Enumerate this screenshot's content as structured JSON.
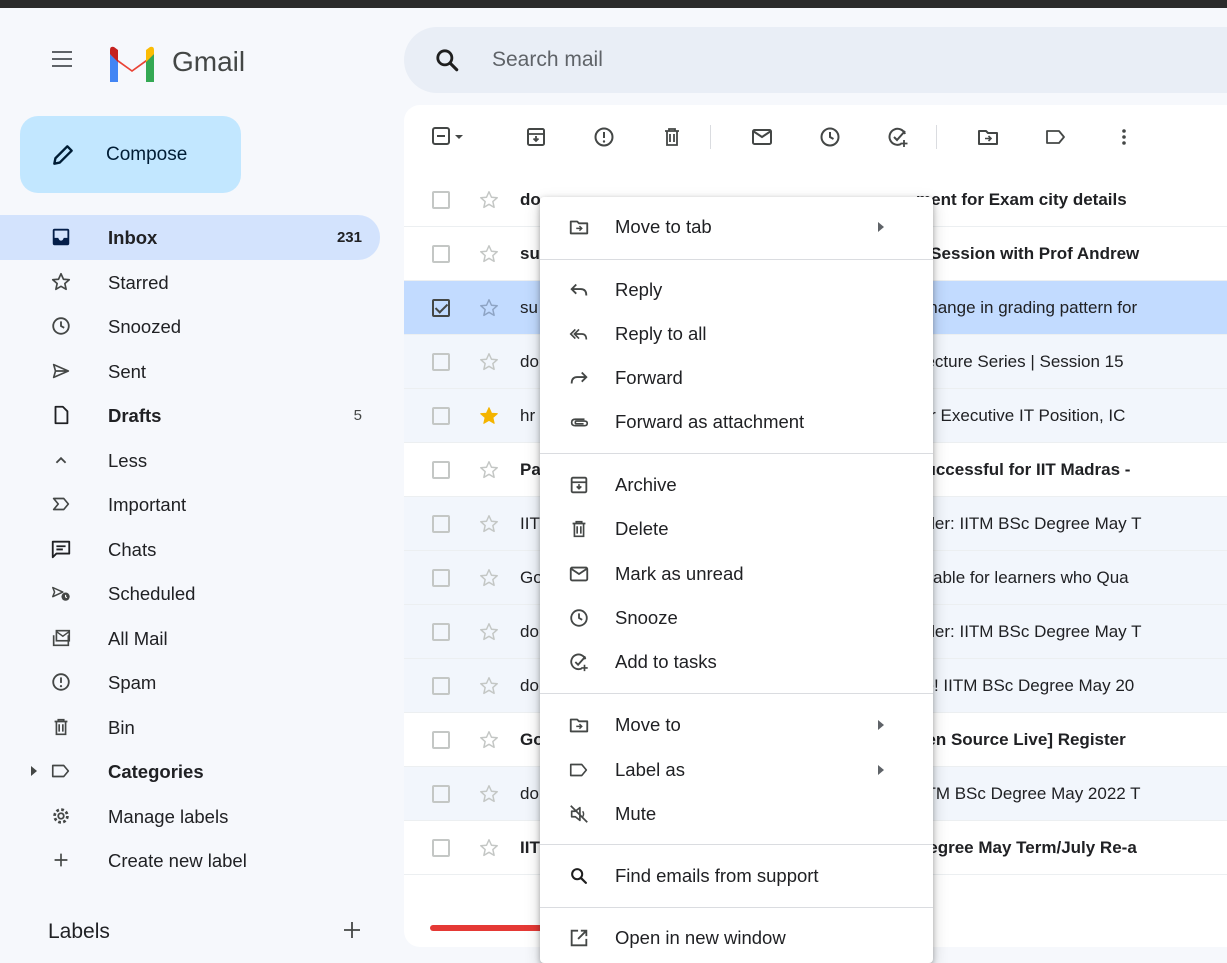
{
  "app": {
    "name": "Gmail"
  },
  "search": {
    "placeholder": "Search mail"
  },
  "compose": {
    "label": "Compose"
  },
  "sidebar": {
    "items": [
      {
        "label": "Inbox",
        "count": "231",
        "icon": "inbox-icon",
        "active": true,
        "bold": true
      },
      {
        "label": "Starred",
        "count": "",
        "icon": "star-icon"
      },
      {
        "label": "Snoozed",
        "count": "",
        "icon": "clock-icon"
      },
      {
        "label": "Sent",
        "count": "",
        "icon": "send-icon"
      },
      {
        "label": "Drafts",
        "count": "5",
        "icon": "draft-icon",
        "bold": true
      },
      {
        "label": "Less",
        "count": "",
        "icon": "chevron-up-icon"
      },
      {
        "label": "Important",
        "count": "",
        "icon": "important-icon"
      },
      {
        "label": "Chats",
        "count": "",
        "icon": "chat-icon"
      },
      {
        "label": "Scheduled",
        "count": "",
        "icon": "scheduled-icon"
      },
      {
        "label": "All Mail",
        "count": "",
        "icon": "all-mail-icon"
      },
      {
        "label": "Spam",
        "count": "",
        "icon": "spam-icon"
      },
      {
        "label": "Bin",
        "count": "",
        "icon": "bin-icon"
      },
      {
        "label": "Categories",
        "count": "",
        "icon": "label-icon",
        "bold": true
      },
      {
        "label": "Manage labels",
        "count": "",
        "icon": "gear-icon"
      },
      {
        "label": "Create new label",
        "count": "",
        "icon": "plus-icon"
      }
    ],
    "labels_heading": "Labels"
  },
  "emails": [
    {
      "sender": "do",
      "subject": "ment for Exam city details",
      "unread": true
    },
    {
      "sender": "su",
      "subject": "e Session with Prof Andrew",
      "unread": true
    },
    {
      "sender": "su",
      "subject": "Change in grading pattern for",
      "selected": true
    },
    {
      "sender": "do",
      "subject": "Lecture Series | Session 15"
    },
    {
      "sender": "hr",
      "subject": "for Executive IT Position, IC",
      "starred": true
    },
    {
      "sender": "Pa",
      "subject": "successful for IIT Madras -",
      "unread": true
    },
    {
      "sender": "IIT",
      "subject": "nder: IITM BSc Degree May T"
    },
    {
      "sender": "Go",
      "subject": "ailable for learners who Qua"
    },
    {
      "sender": "do",
      "subject": "nder: IITM BSc Degree May T"
    },
    {
      "sender": "do",
      "subject": "ce! IITM BSc Degree May 20"
    },
    {
      "sender": "Go",
      "subject": "pen Source Live] Register",
      "unread": true
    },
    {
      "sender": "do",
      "subject": "IITM BSc Degree May 2022 T"
    },
    {
      "sender": "IIT",
      "subject": "Degree May Term/July Re-a",
      "unread": true
    }
  ],
  "context_menu": {
    "items": [
      {
        "label": "Move to tab",
        "icon": "move-to-tab-icon",
        "submenu": true
      },
      {
        "label": "Reply",
        "icon": "reply-icon"
      },
      {
        "label": "Reply to all",
        "icon": "reply-all-icon"
      },
      {
        "label": "Forward",
        "icon": "forward-icon"
      },
      {
        "label": "Forward as attachment",
        "icon": "attachment-icon"
      },
      {
        "label": "Archive",
        "icon": "archive-icon"
      },
      {
        "label": "Delete",
        "icon": "delete-icon"
      },
      {
        "label": "Mark as unread",
        "icon": "mail-icon"
      },
      {
        "label": "Snooze",
        "icon": "clock-icon"
      },
      {
        "label": "Add to tasks",
        "icon": "add-task-icon"
      },
      {
        "label": "Move to",
        "icon": "move-to-icon",
        "submenu": true
      },
      {
        "label": "Label as",
        "icon": "label-icon",
        "submenu": true
      },
      {
        "label": "Mute",
        "icon": "mute-icon"
      },
      {
        "label": "Find emails from support",
        "icon": "search-icon"
      },
      {
        "label": "Open in new window",
        "icon": "open-new-window-icon"
      }
    ]
  },
  "colors": {
    "accent": "#0b57d0",
    "selected_row": "#c2dbff",
    "compose_bg": "#c2e7ff",
    "star_yellow": "#f4b400"
  }
}
